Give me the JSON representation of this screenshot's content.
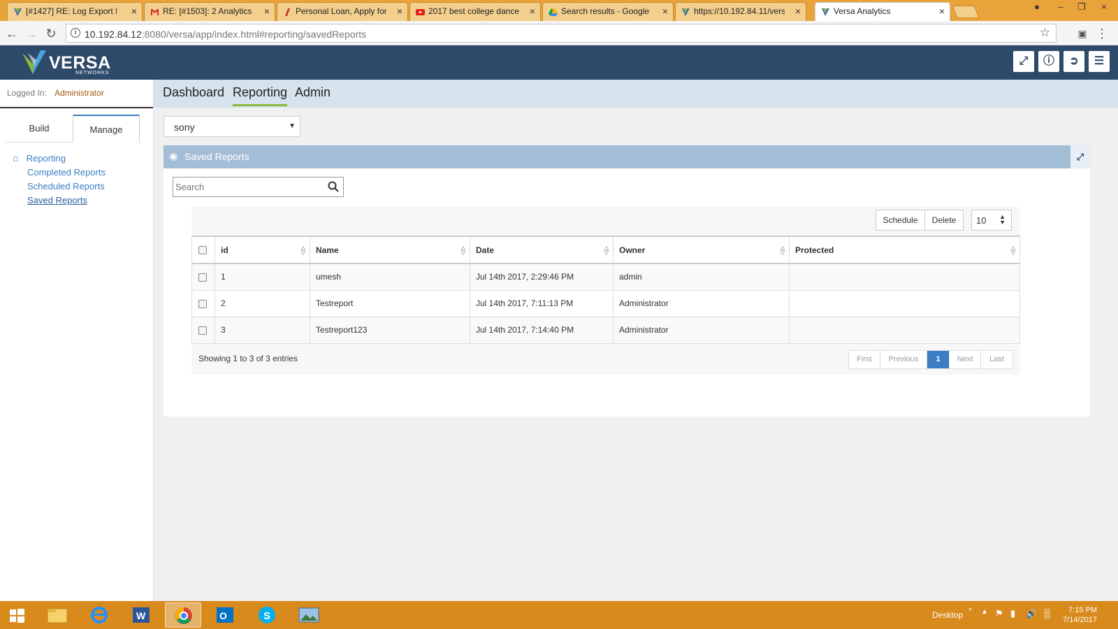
{
  "browser": {
    "tabs": [
      {
        "title": "[#1427] RE: Log Export F",
        "icon": "versa-favicon"
      },
      {
        "title": "RE: [#1503]: 2 Analytics i",
        "icon": "gmail-icon"
      },
      {
        "title": "Personal Loan, Apply for",
        "icon": "loan-icon"
      },
      {
        "title": "2017 best college dance",
        "icon": "youtube-icon"
      },
      {
        "title": "Search results - Google I",
        "icon": "google-drive-icon"
      },
      {
        "title": "https://10.192.84.11/vers",
        "icon": "versa-favicon"
      },
      {
        "title": "Versa Analytics",
        "icon": "versa-favicon"
      }
    ],
    "url_host": "10.192.84.12",
    "url_rest": ":8080/versa/app/index.html#reporting/savedReports"
  },
  "header": {
    "logo_text": "VERSA",
    "logo_sub": "NETWORKS"
  },
  "sidebar": {
    "logged_in_label": "Logged In:",
    "logged_in_user": "Administrator",
    "tabs": [
      "Build",
      "Manage"
    ],
    "home_label": "Reporting",
    "items": [
      "Completed Reports",
      "Scheduled Reports",
      "Saved Reports"
    ]
  },
  "topnav": {
    "items": [
      "Dashboard",
      "Reporting",
      "Admin"
    ]
  },
  "main": {
    "org_selected": "sony",
    "panel_title": "Saved Reports",
    "search_placeholder": "Search",
    "schedule_label": "Schedule",
    "delete_label": "Delete",
    "page_size": "10",
    "columns": [
      "id",
      "Name",
      "Date",
      "Owner",
      "Protected"
    ],
    "rows": [
      {
        "id": "1",
        "name": "umesh",
        "date": "Jul 14th 2017, 2:29:46 PM",
        "owner": "admin",
        "protected": ""
      },
      {
        "id": "2",
        "name": "Testreport",
        "date": "Jul 14th 2017, 7:11:13 PM",
        "owner": "Administrator",
        "protected": ""
      },
      {
        "id": "3",
        "name": "Testreport123",
        "date": "Jul 14th 2017, 7:14:40 PM",
        "owner": "Administrator",
        "protected": ""
      }
    ],
    "showing_text": "Showing 1 to 3 of 3 entries",
    "pager": {
      "first": "First",
      "previous": "Previous",
      "current": "1",
      "next": "Next",
      "last": "Last"
    }
  },
  "taskbar": {
    "desktop_label": "Desktop",
    "time": "7:15 PM",
    "date": "7/14/2017"
  },
  "colors": {
    "header_bg": "#2e4a6a",
    "accent_blue": "#3b7dc4",
    "panel_head": "#a4bdd6",
    "nav_active": "#8ab83a",
    "taskbar": "#d98a1c"
  }
}
